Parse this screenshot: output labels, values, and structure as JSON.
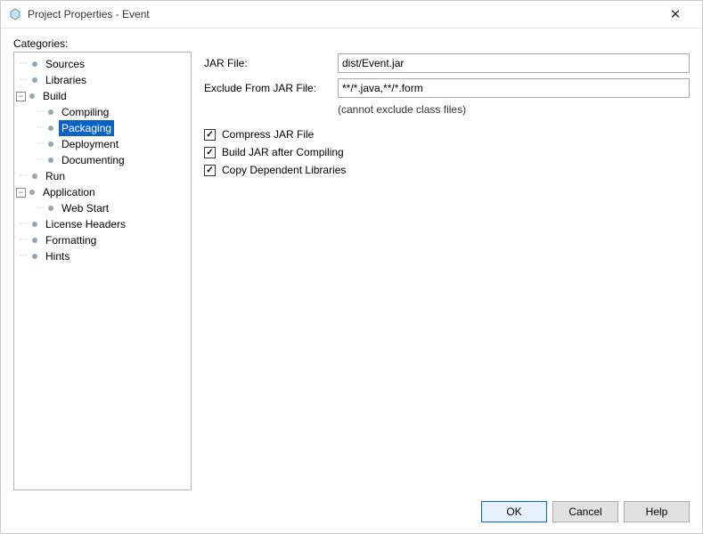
{
  "titlebar": {
    "title": "Project Properties - Event"
  },
  "labels": {
    "categories": "Categories:"
  },
  "tree": {
    "items": [
      {
        "label": "Sources",
        "depth": 1
      },
      {
        "label": "Libraries",
        "depth": 1
      },
      {
        "label": "Build",
        "depth": 1,
        "expandable": true,
        "expanded": true,
        "children": [
          {
            "label": "Compiling"
          },
          {
            "label": "Packaging",
            "selected": true
          },
          {
            "label": "Deployment"
          },
          {
            "label": "Documenting"
          }
        ]
      },
      {
        "label": "Run",
        "depth": 1
      },
      {
        "label": "Application",
        "depth": 1,
        "expandable": true,
        "expanded": true,
        "children": [
          {
            "label": "Web Start"
          }
        ]
      },
      {
        "label": "License Headers",
        "depth": 1
      },
      {
        "label": "Formatting",
        "depth": 1
      },
      {
        "label": "Hints",
        "depth": 1
      }
    ]
  },
  "form": {
    "jar_file_label": "JAR File:",
    "jar_file_value": "dist/Event.jar",
    "exclude_label": "Exclude From JAR File:",
    "exclude_value": "**/*.java,**/*.form",
    "exclude_hint": "(cannot exclude class files)",
    "checks": {
      "compress": {
        "label": "Compress JAR File",
        "checked": true
      },
      "build_after": {
        "label": "Build JAR after Compiling",
        "checked": true
      },
      "copy_deps": {
        "label": "Copy Dependent Libraries",
        "checked": true
      }
    }
  },
  "buttons": {
    "ok": "OK",
    "cancel": "Cancel",
    "help": "Help"
  }
}
